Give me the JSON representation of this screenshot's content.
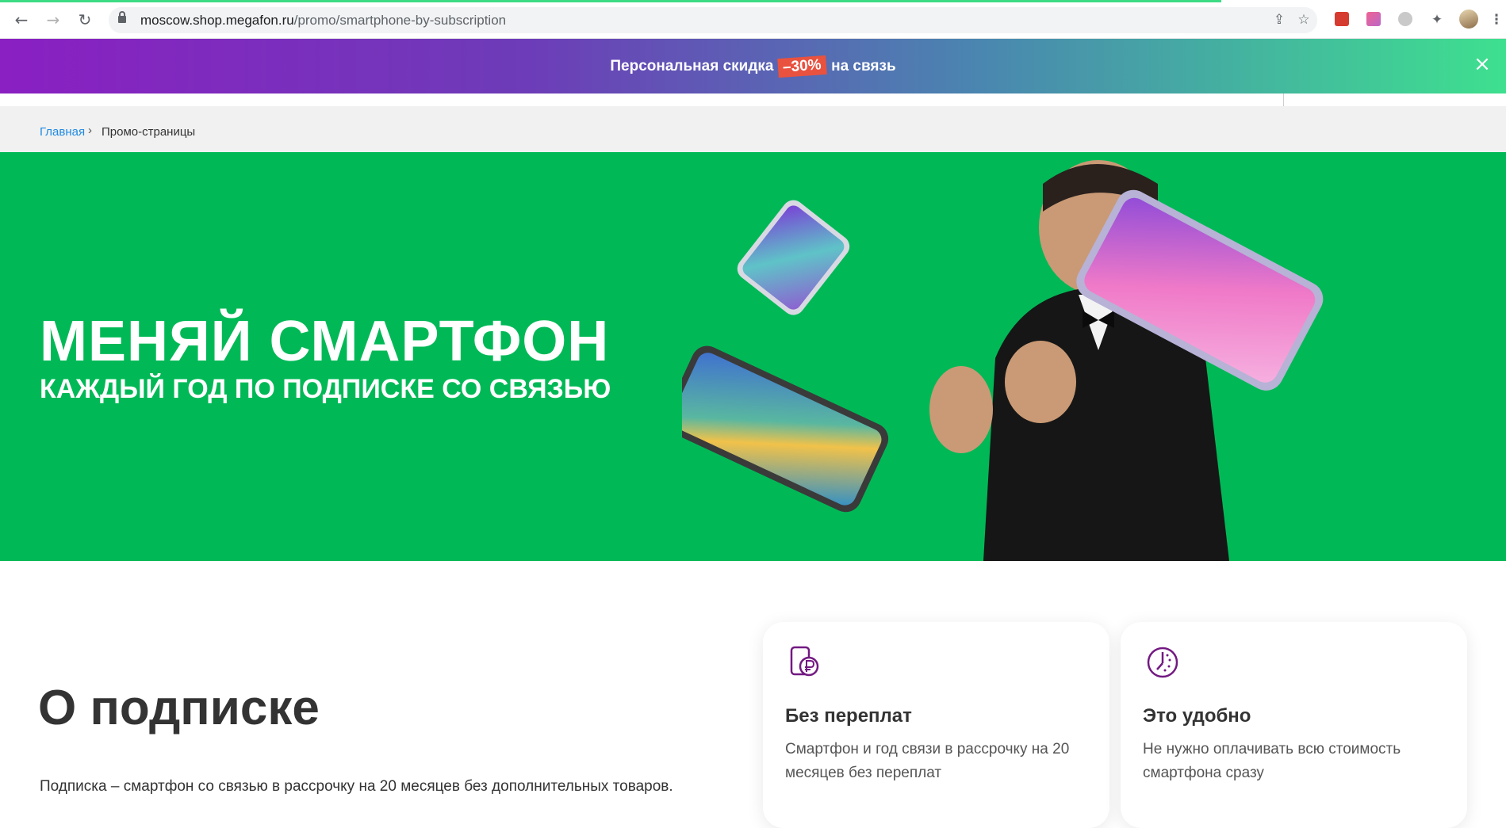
{
  "browser": {
    "url_domain": "moscow.shop.megafon.ru",
    "url_path": "/promo/smartphone-by-subscription"
  },
  "promo": {
    "text_before": "Персональная скидка",
    "discount": "–30%",
    "text_after": "на связь"
  },
  "breadcrumbs": {
    "home": "Главная",
    "current": "Промо-страницы"
  },
  "hero": {
    "title": "МЕНЯЙ СМАРТФОН",
    "subtitle": "КАЖДЫЙ ГОД ПО ПОДПИСКЕ СО СВЯЗЬЮ"
  },
  "about": {
    "title": "О подписке",
    "text": "Подписка – смартфон со связью в рассрочку на 20 месяцев без дополнительных товаров."
  },
  "cards": [
    {
      "icon": "phone-ruble-icon",
      "title": "Без переплат",
      "text": "Смартфон и год связи в рассрочку на 20 месяцев без переплат"
    },
    {
      "icon": "clock-icon",
      "title": "Это удобно",
      "text": "Не нужно оплачивать всю стоимость смартфона сразу"
    }
  ],
  "colors": {
    "brand_green": "#00b956",
    "brand_purple": "#731982",
    "link_blue": "#1f8ae3",
    "badge_red": "#e9523f"
  }
}
